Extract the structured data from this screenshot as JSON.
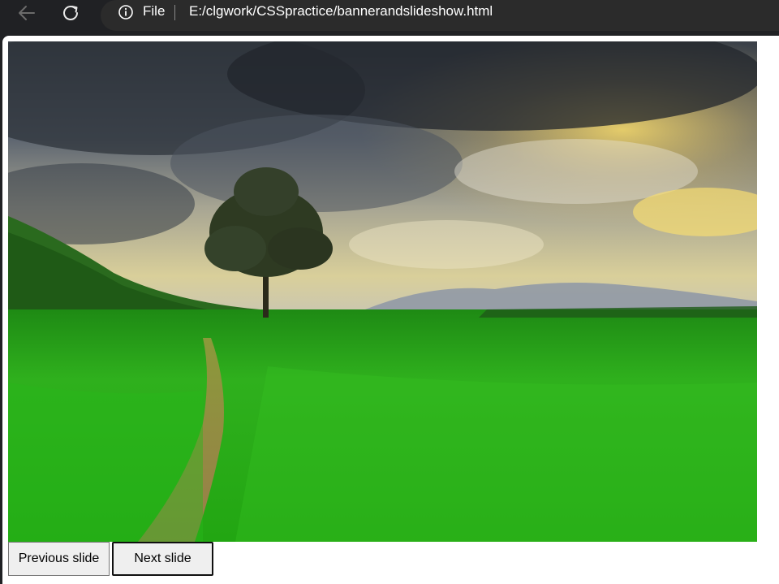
{
  "browser": {
    "scheme_label": "File",
    "url": "E:/clgwork/CSSpractice/bannerandslideshow.html",
    "icons": {
      "back": "arrow-left-icon",
      "reload": "reload-icon",
      "info": "info-icon"
    }
  },
  "slideshow": {
    "image_description_hidden": true,
    "prev_label": "Previous slide",
    "next_label": "Next slide"
  },
  "colors": {
    "chrome_bg": "#202124",
    "address_bg": "#2b2b2b",
    "page_bg": "#ffffff",
    "button_bg": "#efefef"
  }
}
